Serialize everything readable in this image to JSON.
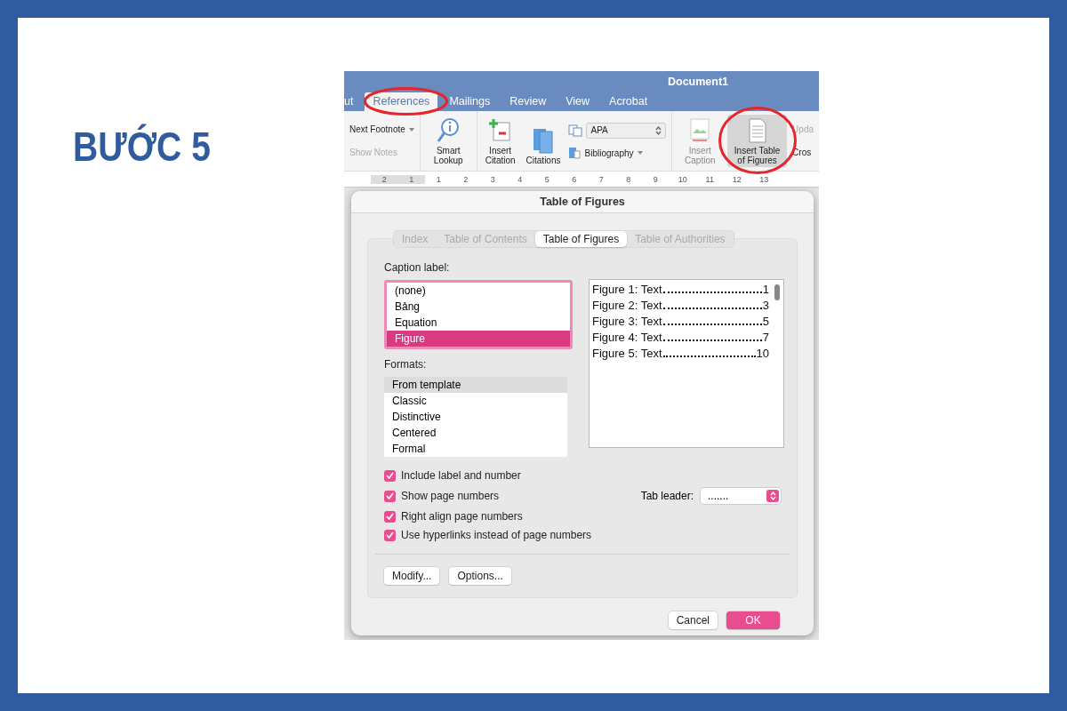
{
  "heading": "BƯỚC 5",
  "window": {
    "title": "Document1"
  },
  "ribbon_tabs": [
    {
      "label": "ut",
      "selected": false
    },
    {
      "label": "References",
      "selected": true
    },
    {
      "label": "Mailings",
      "selected": false
    },
    {
      "label": "Review",
      "selected": false
    },
    {
      "label": "View",
      "selected": false
    },
    {
      "label": "Acrobat",
      "selected": false
    }
  ],
  "ribbon_groups": [
    [
      {
        "kind": "stack",
        "items": [
          {
            "kind": "menu",
            "label": "Next Footnote",
            "disabled": false
          },
          {
            "kind": "text",
            "label": "Show Notes",
            "disabled": true
          }
        ]
      }
    ],
    [
      {
        "kind": "large",
        "label": "Smart Lookup",
        "disabled": false,
        "pressed": false
      }
    ],
    [
      {
        "kind": "large",
        "label": "Insert Citation",
        "disabled": false,
        "pressed": false
      },
      {
        "kind": "large",
        "label": "Citations",
        "disabled": false,
        "pressed": false
      },
      {
        "kind": "stack",
        "items": [
          {
            "kind": "select",
            "label": "APA",
            "disabled": false
          },
          {
            "kind": "menu",
            "label": "Bibliography",
            "disabled": false
          }
        ]
      }
    ],
    [
      {
        "kind": "large",
        "label": "Insert Caption",
        "disabled": true,
        "pressed": false
      },
      {
        "kind": "large",
        "label": "Insert Table of Figures",
        "disabled": false,
        "pressed": true
      },
      {
        "kind": "stack",
        "items": [
          {
            "kind": "text",
            "label": "Upda",
            "disabled": true
          },
          {
            "kind": "text",
            "label": "Cros",
            "disabled": false
          }
        ]
      }
    ]
  ],
  "ruler": [
    "2",
    "1",
    "1",
    "2",
    "3",
    "4",
    "5",
    "6",
    "7",
    "8",
    "9",
    "10",
    "11",
    "12",
    "13"
  ],
  "dialog": {
    "title": "Table of Figures",
    "tabs": [
      {
        "label": "Index",
        "selected": false
      },
      {
        "label": "Table of Contents",
        "selected": false
      },
      {
        "label": "Table of Figures",
        "selected": true
      },
      {
        "label": "Table of Authorities",
        "selected": false
      }
    ],
    "caption_label": {
      "label": "Caption label:",
      "items": [
        {
          "label": "(none)",
          "selected": false
        },
        {
          "label": "Bảng",
          "selected": false
        },
        {
          "label": "Equation",
          "selected": false
        },
        {
          "label": "Figure",
          "selected": true
        }
      ]
    },
    "preview": [
      {
        "text": "Figure 1: Text",
        "page": "1"
      },
      {
        "text": "Figure 2: Text",
        "page": "3"
      },
      {
        "text": "Figure 3: Text",
        "page": "5"
      },
      {
        "text": "Figure 4: Text",
        "page": "7"
      },
      {
        "text": "Figure 5: Text",
        "page": "10"
      }
    ],
    "formats": {
      "label": "Formats:",
      "items": [
        {
          "label": "From template",
          "selected": true
        },
        {
          "label": "Classic",
          "selected": false
        },
        {
          "label": "Distinctive",
          "selected": false
        },
        {
          "label": "Centered",
          "selected": false
        },
        {
          "label": "Formal",
          "selected": false
        }
      ]
    },
    "options": [
      {
        "label": "Include label and number",
        "checked": true
      },
      {
        "label": "Show page numbers",
        "checked": true
      },
      {
        "label": "Right align page numbers",
        "checked": true
      },
      {
        "label": "Use hyperlinks instead of page numbers",
        "checked": true
      }
    ],
    "tab_leader": {
      "label": "Tab leader:",
      "value": "......."
    },
    "buttons": [
      {
        "label": "Modify...",
        "default": false
      },
      {
        "label": "Options...",
        "default": false
      }
    ],
    "footer_buttons": [
      {
        "label": "Cancel",
        "default": false
      },
      {
        "label": "OK",
        "default": true
      }
    ]
  }
}
